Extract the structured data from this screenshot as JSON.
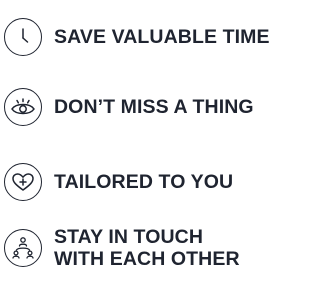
{
  "features": [
    {
      "icon": "clock-icon",
      "lines": [
        "SAVE VALUABLE TIME"
      ]
    },
    {
      "icon": "eye-icon",
      "lines": [
        "DON’T MISS A THING"
      ]
    },
    {
      "icon": "heart-plus-icon",
      "lines": [
        "TAILORED TO YOU"
      ]
    },
    {
      "icon": "people-network-icon",
      "lines": [
        "STAY IN TOUCH",
        "WITH EACH OTHER"
      ]
    }
  ],
  "colors": {
    "text": "#1f2430",
    "icon_stroke": "#1f2430",
    "background": "#ffffff"
  }
}
